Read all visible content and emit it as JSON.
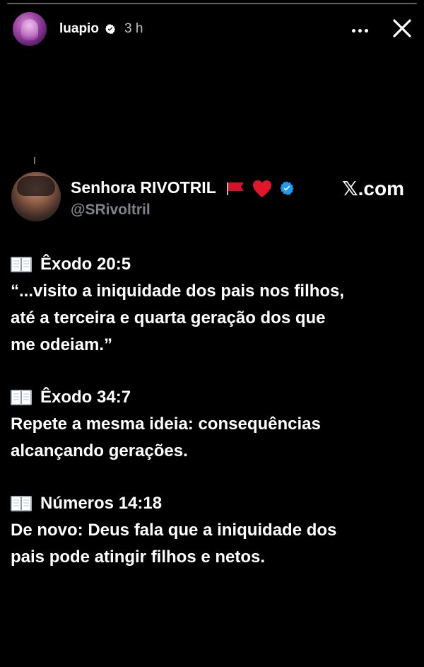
{
  "story": {
    "progress": 0,
    "username": "luapio",
    "time": "3 h"
  },
  "tweet": {
    "display_name": "Senhora RIVOTRIL",
    "handle": "@SRivoltril",
    "brand": "𝕏.com",
    "verses": [
      {
        "reference": "Êxodo 20:5",
        "text": "“...visito a iniquidade dos pais nos filhos,\naté a terceira e quarta geração dos que\nme odeiam.”"
      },
      {
        "reference": "Êxodo 34:7",
        "text": "Repete a mesma ideia: consequências\nalcançando gerações."
      },
      {
        "reference": "Números 14:18",
        "text": "De novo: Deus fala que a iniquidade dos\npais pode atingir filhos e netos."
      }
    ]
  },
  "colors": {
    "background": "#000000",
    "verified_blue": "#1D9BF0",
    "handle_gray": "#7F8489",
    "flag_red": "#D3132B",
    "heart_red": "#E0162B"
  },
  "icons": {
    "book": "open-book-icon",
    "verified": "verified-badge-icon",
    "flag": "red-flag-icon",
    "heart": "red-heart-icon",
    "more": "more-options-icon",
    "close": "close-icon"
  }
}
